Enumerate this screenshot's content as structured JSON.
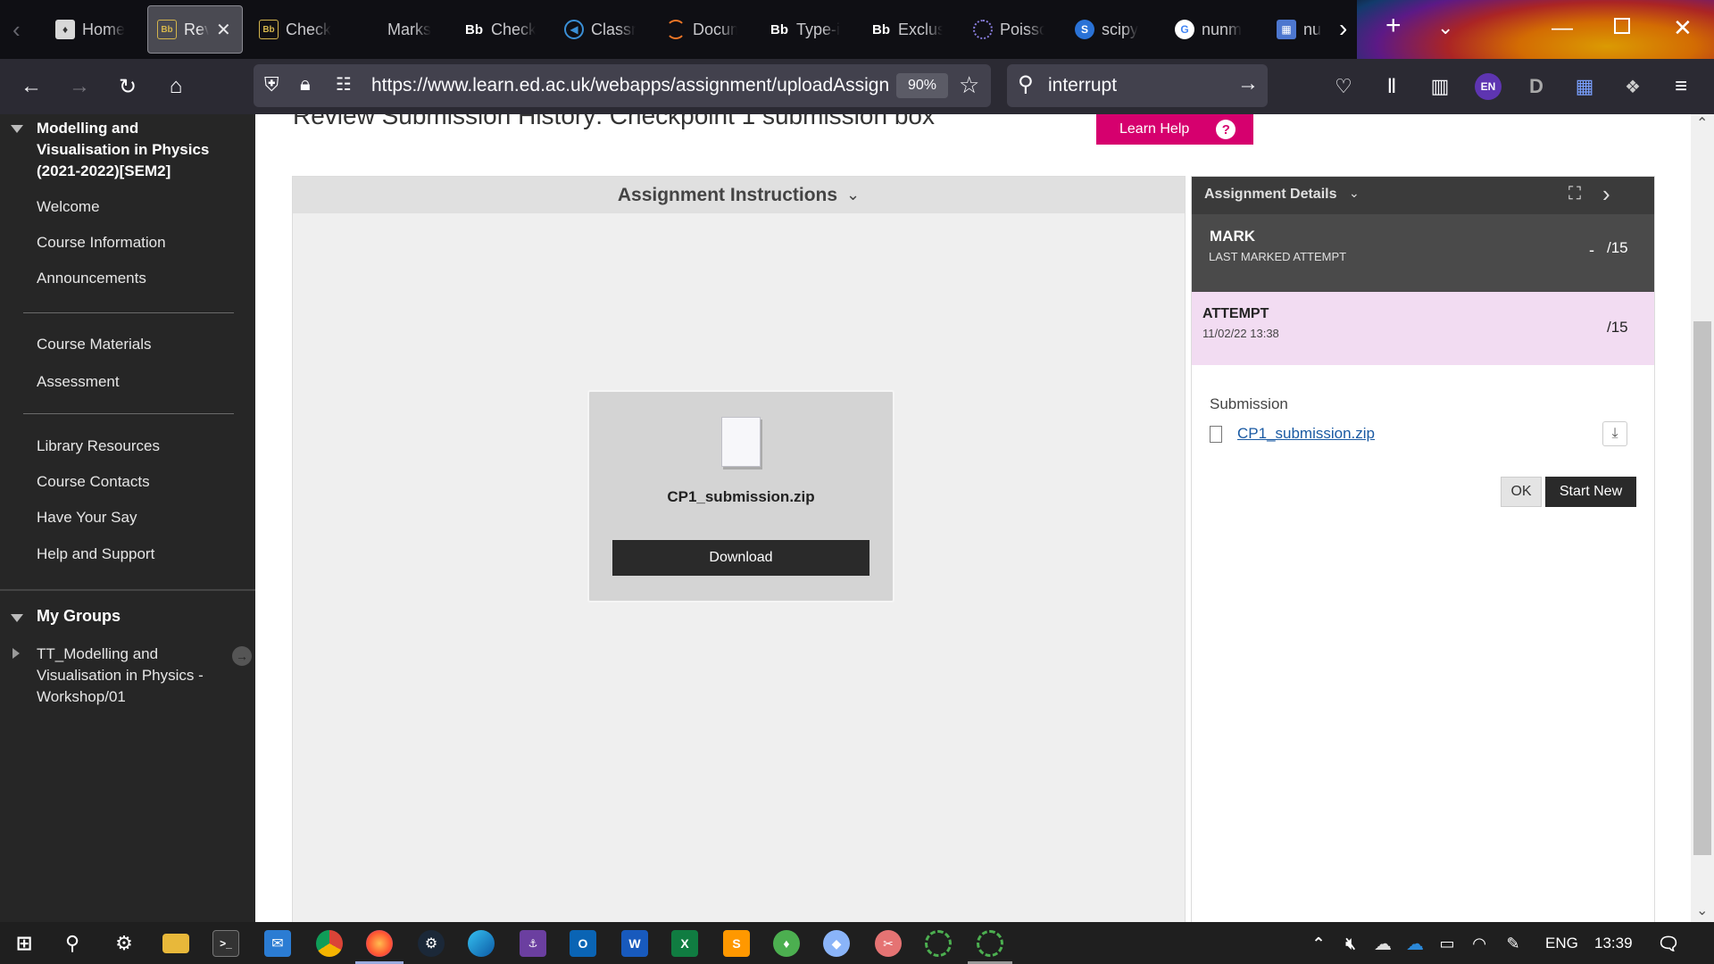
{
  "browser": {
    "tabs": [
      {
        "label": "Home",
        "icon": "uoe-crest-icon"
      },
      {
        "label": "Rev",
        "icon": "blackboard-icon",
        "active": true
      },
      {
        "label": "Check",
        "icon": "blackboard-icon"
      },
      {
        "label": "Marks",
        "icon": "document-icon"
      },
      {
        "label": "Check",
        "icon": "bb-icon"
      },
      {
        "label": "Classr",
        "icon": "classroom-icon"
      },
      {
        "label": "Docum",
        "icon": "jupyter-icon"
      },
      {
        "label": "Type-i",
        "icon": "bb-icon"
      },
      {
        "label": "Exclus",
        "icon": "bb-icon"
      },
      {
        "label": "Poissc",
        "icon": "loading-icon"
      },
      {
        "label": "scipy",
        "icon": "scipy-icon"
      },
      {
        "label": "nunm",
        "icon": "google-icon"
      },
      {
        "label": "nu",
        "icon": "numpy-icon"
      }
    ],
    "url": "https://www.learn.ed.ac.uk/webapps/assignment/uploadAssignment",
    "zoom": "90%",
    "search_query": "interrupt",
    "profile_badge": "EN"
  },
  "course_menu": {
    "course_title": "Modelling and Visualisation in Physics (2021-2022)[SEM2]",
    "items_group1": [
      "Welcome",
      "Course Information",
      "Announcements"
    ],
    "items_group2": [
      "Course Materials",
      "Assessment"
    ],
    "items_group3": [
      "Library Resources",
      "Course Contacts",
      "Have Your Say",
      "Help and Support"
    ],
    "groups_heading": "My Groups",
    "group_name": "TT_Modelling and Visualisation in Physics - Workshop/01"
  },
  "page": {
    "title": "Review Submission History: Checkpoint 1 submission box",
    "learn_help": "Learn Help",
    "instructions_heading": "Assignment Instructions",
    "file_card": {
      "filename": "CP1_submission.zip",
      "download_label": "Download"
    },
    "details": {
      "heading": "Assignment Details",
      "mark_label": "MARK",
      "mark_sublabel": "LAST MARKED ATTEMPT",
      "mark_value": "-",
      "mark_total": "/15",
      "attempt_label": "ATTEMPT",
      "attempt_date": "11/02/22 13:38",
      "attempt_total": "/15",
      "submission_label": "Submission",
      "submission_file": "CP1_submission.zip",
      "ok_label": "OK",
      "start_new_label": "Start New"
    }
  },
  "taskbar": {
    "language": "ENG",
    "time": "13:39"
  },
  "colors": {
    "learn_help_pink": "#d6006e",
    "details_header": "#3b3b3b",
    "attempt_bg": "#f2dcf2",
    "link_blue": "#1a5aa3"
  }
}
